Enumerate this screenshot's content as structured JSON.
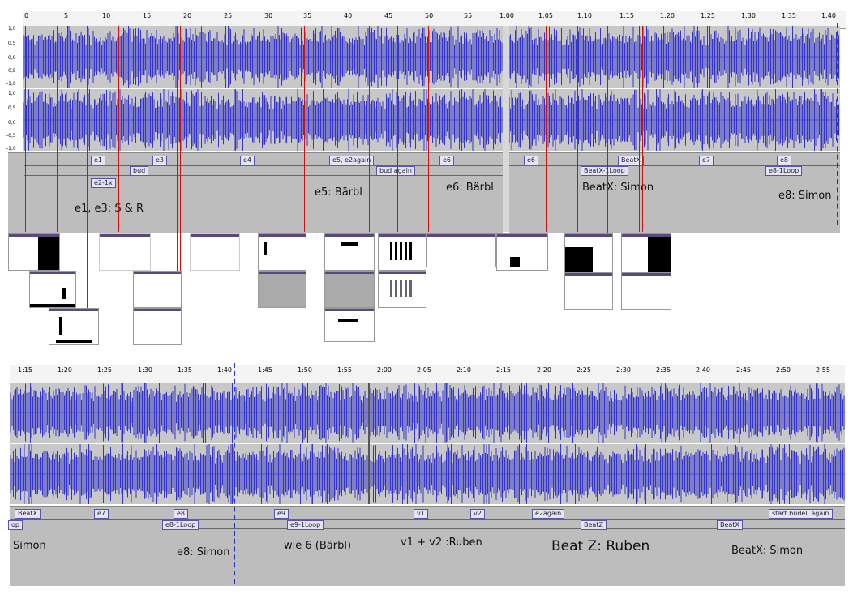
{
  "top": {
    "ruler_ticks": [
      "0",
      "5",
      "10",
      "15",
      "20",
      "25",
      "30",
      "35",
      "40",
      "45",
      "50",
      "55",
      "1:00",
      "1:05",
      "1:10",
      "1:15",
      "1:20",
      "1:25",
      "1:30",
      "1:35",
      "1:40"
    ],
    "scale_labels": [
      "1,0",
      "0,5",
      "0,0",
      "-0,5",
      "-1,0"
    ],
    "label_boxes": [
      "e1",
      "e3",
      "bud",
      "e2-1x",
      "e4",
      "e5, e2again",
      "bud again",
      "e6",
      "e6",
      "BeatX-1Loop",
      "BeatX",
      "e7",
      "e8",
      "e8-1Loop"
    ],
    "big_labels": [
      "e1, e3: S & R",
      "e5: Bärbl",
      "e6: Bärbl",
      "BeatX: Simon",
      "e8: Simon"
    ]
  },
  "bottom": {
    "ruler_ticks": [
      "1:15",
      "1:20",
      "1:25",
      "1:30",
      "1:35",
      "1:40",
      "1:45",
      "1:50",
      "1:55",
      "2:00",
      "2:05",
      "2:10",
      "2:15",
      "2:20",
      "2:25",
      "2:30",
      "2:35",
      "2:40",
      "2:45",
      "2:50",
      "2:55"
    ],
    "label_boxes": [
      "BeatX",
      "op",
      "e7",
      "e8",
      "e8-1Loop",
      "e9",
      "e9-1Loop",
      "v1",
      "v2",
      "e2again",
      "BeatZ",
      "BeatX",
      "start budeli again"
    ],
    "big_labels": [
      "Simon",
      "e8: Simon",
      "wie 6 (Bärbl)",
      "v1 + v2 :Ruben",
      "Beat Z: Ruben",
      "BeatX: Simon"
    ]
  },
  "colors": {
    "waveform": "#3434c8",
    "marker": "#cc1111",
    "track_bg": "#c8c8c8",
    "label_track_bg": "#bdbdbd",
    "playhead": "#2233cc"
  }
}
